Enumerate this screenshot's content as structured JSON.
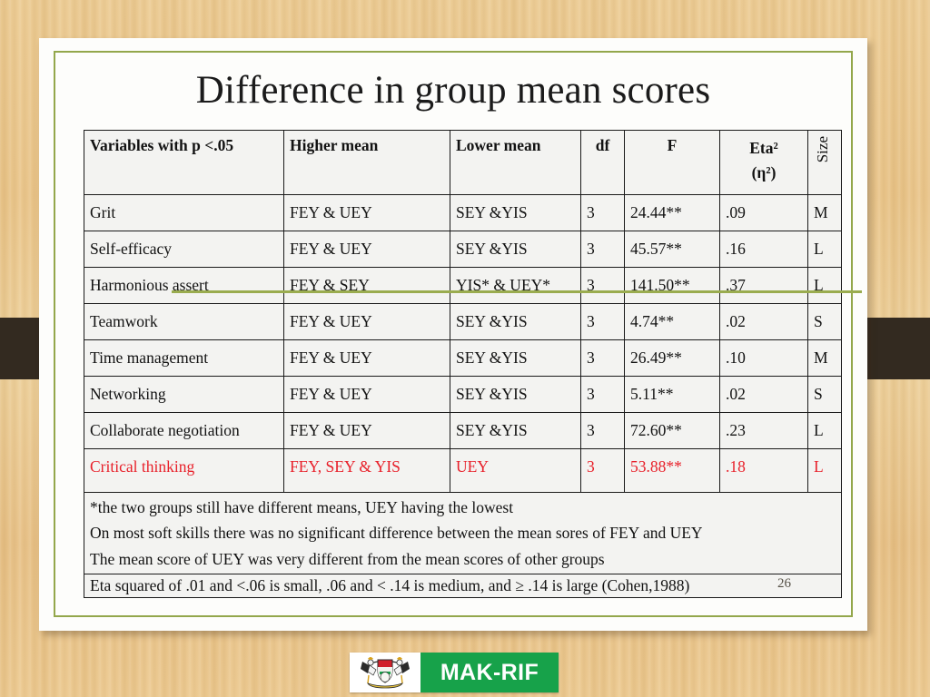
{
  "slide": {
    "title": "Difference in group mean scores",
    "number": "26"
  },
  "table": {
    "headers": {
      "variables": "Variables with p <.05",
      "higher_mean": "Higher mean",
      "lower_mean": "Lower mean",
      "df": "df",
      "f": "F",
      "eta_line1": "Eta²",
      "eta_line2": "(η²)",
      "size": "Size"
    },
    "rows": [
      {
        "variable": "Grit",
        "higher_mean": "FEY & UEY",
        "lower_mean": "SEY &YIS",
        "df": "3",
        "f": "24.44**",
        "eta": ".09",
        "size": "M",
        "highlight": false
      },
      {
        "variable": "Self-efficacy",
        "higher_mean": "FEY & UEY",
        "lower_mean": "SEY &YIS",
        "df": "3",
        "f": "45.57**",
        "eta": ".16",
        "size": "L",
        "highlight": false
      },
      {
        "variable": "Harmonious assert",
        "higher_mean": "FEY & SEY",
        "lower_mean": "YIS* & UEY*",
        "df": "3",
        "f": "141.50**",
        "eta": ".37",
        "size": "L",
        "highlight": false
      },
      {
        "variable": "Teamwork",
        "higher_mean": "FEY & UEY",
        "lower_mean": "SEY &YIS",
        "df": "3",
        "f": "4.74**",
        "eta": ".02",
        "size": "S",
        "highlight": false
      },
      {
        "variable": "Time management",
        "higher_mean": "FEY & UEY",
        "lower_mean": "SEY &YIS",
        "df": "3",
        "f": "26.49**",
        "eta": ".10",
        "size": "M",
        "highlight": false
      },
      {
        "variable": "Networking",
        "higher_mean": "FEY & UEY",
        "lower_mean": "SEY &YIS",
        "df": "3",
        "f": "5.11**",
        "eta": ".02",
        "size": "S",
        "highlight": false
      },
      {
        "variable": "Collaborate negotiation",
        "higher_mean": "FEY & UEY",
        "lower_mean": "SEY &YIS",
        "df": "3",
        "f": "72.60**",
        "eta": ".23",
        "size": "L",
        "highlight": false
      },
      {
        "variable": "Critical thinking",
        "higher_mean": "FEY, SEY & YIS",
        "lower_mean": "UEY",
        "df": "3",
        "f": "53.88**",
        "eta": ".18",
        "size": "L",
        "highlight": true
      }
    ],
    "notes": [
      "*the two groups still have different means, UEY having the lowest",
      "On most soft skills there was no significant difference between the mean sores of FEY and UEY",
      "The mean score of UEY was very different from the mean scores of other groups"
    ],
    "footnote": "Eta squared of .01 and <.06 is small, .06 and < .14 is medium, and ≥ .14 is large (Cohen,1988)"
  },
  "logo": {
    "label": "MAK-RIF"
  },
  "colors": {
    "highlight_red": "#e8202a",
    "accent_green": "#93a74b",
    "logo_green": "#17a24a",
    "background_wood": "#eecb8f",
    "band_dark": "#332a20"
  }
}
